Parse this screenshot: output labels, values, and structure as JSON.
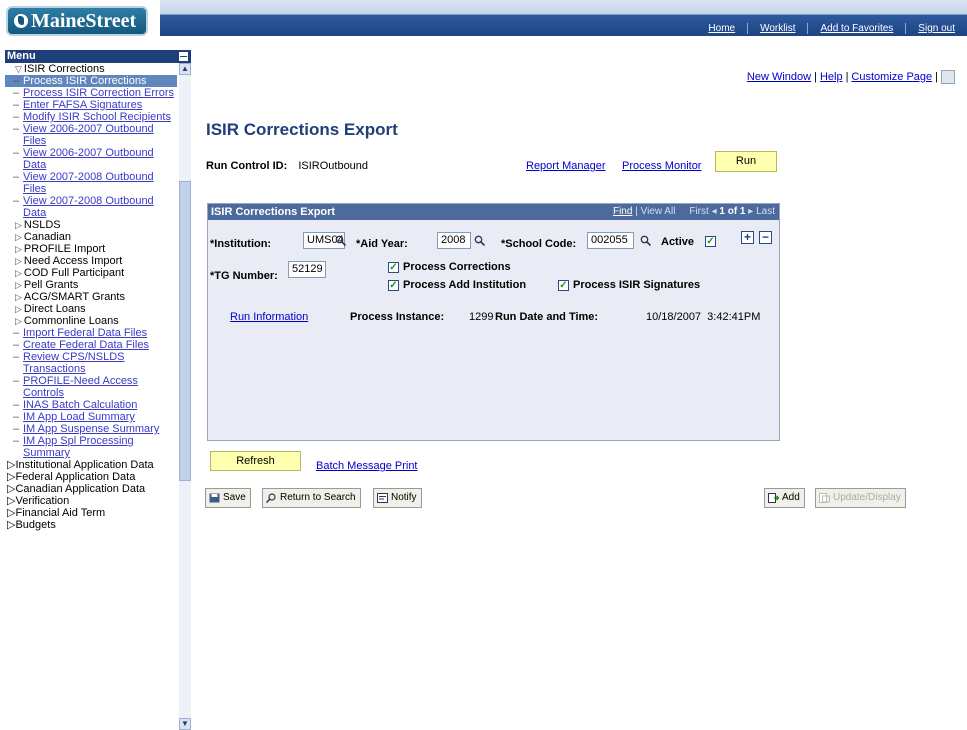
{
  "header": {
    "logo_text": "MaineStreet",
    "links": [
      "Home",
      "Worklist",
      "Add to Favorites",
      "Sign out"
    ]
  },
  "menu": {
    "title": "Menu",
    "items": [
      {
        "level": 1,
        "label": "ISIR Corrections",
        "expanded": true
      },
      {
        "level": 2,
        "label": "Process ISIR Corrections",
        "selected": true
      },
      {
        "level": 2,
        "label": "Process ISIR Correction Errors"
      },
      {
        "level": 2,
        "label": "Enter FAFSA Signatures"
      },
      {
        "level": 2,
        "label": "Modify ISIR School Recipients"
      },
      {
        "level": 2,
        "label": "View 2006-2007 Outbound Files"
      },
      {
        "level": 2,
        "label": "View 2006-2007 Outbound Data"
      },
      {
        "level": 2,
        "label": "View 2007-2008 Outbound Files"
      },
      {
        "level": 2,
        "label": "View 2007-2008 Outbound Data"
      },
      {
        "level": 1,
        "label": "NSLDS"
      },
      {
        "level": 1,
        "label": "Canadian"
      },
      {
        "level": 1,
        "label": "PROFILE Import"
      },
      {
        "level": 1,
        "label": "Need Access Import"
      },
      {
        "level": 1,
        "label": "COD Full Participant"
      },
      {
        "level": 1,
        "label": "Pell Grants"
      },
      {
        "level": 1,
        "label": "ACG/SMART Grants"
      },
      {
        "level": 1,
        "label": "Direct Loans"
      },
      {
        "level": 1,
        "label": "Commonline Loans"
      },
      {
        "level": 2,
        "label": "Import Federal Data Files"
      },
      {
        "level": 2,
        "label": "Create Federal Data Files"
      },
      {
        "level": 2,
        "label": "Review CPS/NSLDS Transactions"
      },
      {
        "level": 2,
        "label": "PROFILE-Need Access Controls"
      },
      {
        "level": 2,
        "label": "INAS Batch Calculation"
      },
      {
        "level": 2,
        "label": "IM App Load Summary"
      },
      {
        "level": 2,
        "label": "IM App Suspense Summary"
      },
      {
        "level": 2,
        "label": "IM App Spl Processing Summary"
      },
      {
        "level": 0,
        "label": "Institutional Application Data"
      },
      {
        "level": 0,
        "label": "Federal Application Data"
      },
      {
        "level": 0,
        "label": "Canadian Application Data"
      },
      {
        "level": 0,
        "label": "Verification"
      },
      {
        "level": 0,
        "label": "Financial Aid Term"
      },
      {
        "level": 0,
        "label": "Budgets"
      }
    ]
  },
  "toolbar_links": {
    "new_window": "New Window",
    "help": "Help",
    "customize": "Customize Page"
  },
  "page": {
    "title": "ISIR Corrections Export",
    "run_control_label": "Run Control ID:",
    "run_control_value": "ISIROutbound",
    "report_manager": "Report Manager",
    "process_monitor": "Process Monitor",
    "run_button": "Run"
  },
  "panel": {
    "title": "ISIR Corrections Export",
    "nav_find": "Find",
    "nav_view_all": "View All",
    "nav_first": "First",
    "nav_count": "1 of 1",
    "nav_last": "Last",
    "institution_label": "*Institution:",
    "institution_value": "UMS04",
    "aid_year_label": "*Aid Year:",
    "aid_year_value": "2008",
    "school_code_label": "*School Code:",
    "school_code_value": "002055",
    "active_label": "Active",
    "active_checked": true,
    "tg_number_label": "*TG Number:",
    "tg_number_value": "52129",
    "process_corrections_label": "Process Corrections",
    "process_add_institution_label": "Process Add Institution",
    "process_isir_signatures_label": "Process ISIR Signatures",
    "run_information": "Run Information",
    "process_instance_label": "Process Instance:",
    "process_instance_value": "1299",
    "run_date_label": "Run Date and Time:",
    "run_date_value": "10/18/2007  3:42:41PM"
  },
  "footer": {
    "refresh": "Refresh",
    "batch_message_print": "Batch Message Print",
    "save": "Save",
    "return_to_search": "Return to Search",
    "notify": "Notify",
    "add": "Add",
    "update_display": "Update/Display"
  }
}
